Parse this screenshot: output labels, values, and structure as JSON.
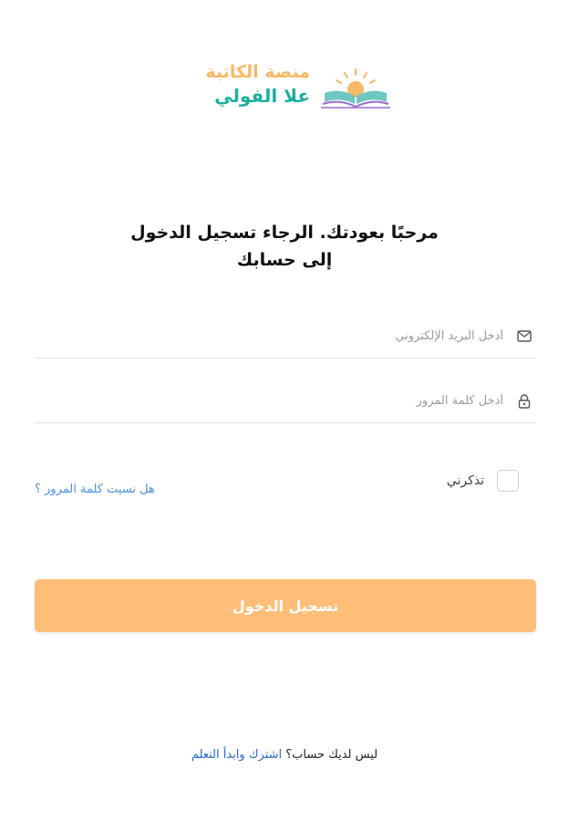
{
  "logo": {
    "line1": "منصة الكاتبة",
    "line2": "علا الفولي"
  },
  "headline": {
    "line1": "مرحبًا بعودتك. الرجاء تسجيل الدخول",
    "line2": "إلى حسابك"
  },
  "form": {
    "email_placeholder": "أدخل البريد الإلكتروني",
    "email_value": "",
    "password_placeholder": "أدخل كلمة المرور",
    "password_value": "",
    "remember_label": "تذكرني",
    "remember_checked": false,
    "forgot_link": "هل نسيت كلمة المرور ؟",
    "login_button": "تسجيل الدخول"
  },
  "signup": {
    "prompt": "ليس لديك حساب؟",
    "link": "اشترك وابدأ التعلم"
  },
  "colors": {
    "accent_orange": "#ffbe78",
    "logo_orange": "#f7b867",
    "logo_teal": "#1fae9f",
    "link_blue": "#4a90e2"
  },
  "icons": [
    "book-logo-icon",
    "mail-icon",
    "lock-icon"
  ]
}
